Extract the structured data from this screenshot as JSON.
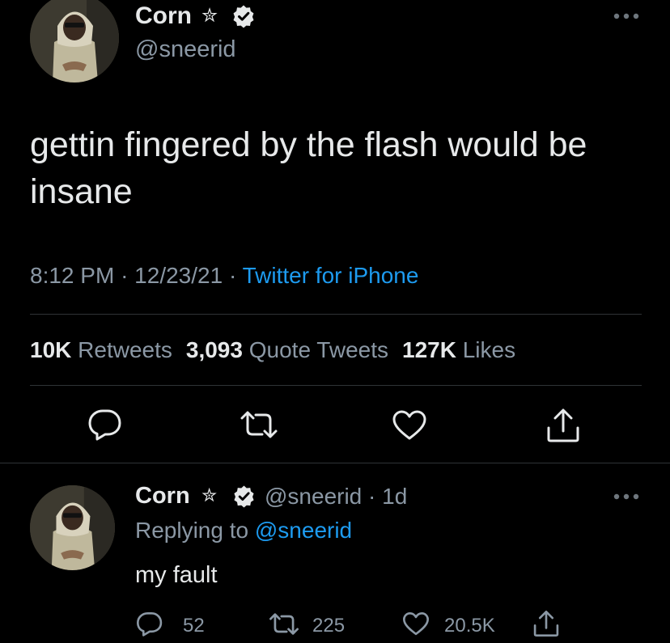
{
  "tweet": {
    "author": {
      "name": "Corn",
      "name_glyph": "✮",
      "handle": "@sneerid",
      "verified": true
    },
    "text": "gettin fingered by the flash would be insane",
    "time": "8:12 PM",
    "date": "12/23/21",
    "separator": "·",
    "source": "Twitter for iPhone",
    "stats": {
      "retweets_count": "10K",
      "retweets_label": "Retweets",
      "quotes_count": "3,093",
      "quotes_label": "Quote Tweets",
      "likes_count": "127K",
      "likes_label": "Likes"
    },
    "actions": [
      "reply-icon",
      "retweet-icon",
      "like-icon",
      "share-icon"
    ]
  },
  "reply": {
    "author": {
      "name": "Corn",
      "name_glyph": "✮",
      "handle": "@sneerid",
      "age": "· 1d",
      "verified": true
    },
    "replying_prefix": "Replying to",
    "replying_to": "@sneerid",
    "text": "my fault",
    "counts": {
      "replies": "52",
      "retweets": "225",
      "likes": "20.5K"
    }
  },
  "colors": {
    "background": "#000000",
    "text": "#e7e9ea",
    "secondary": "#8b98a5",
    "accent": "#1d9bf0",
    "divider": "#2f3336"
  }
}
